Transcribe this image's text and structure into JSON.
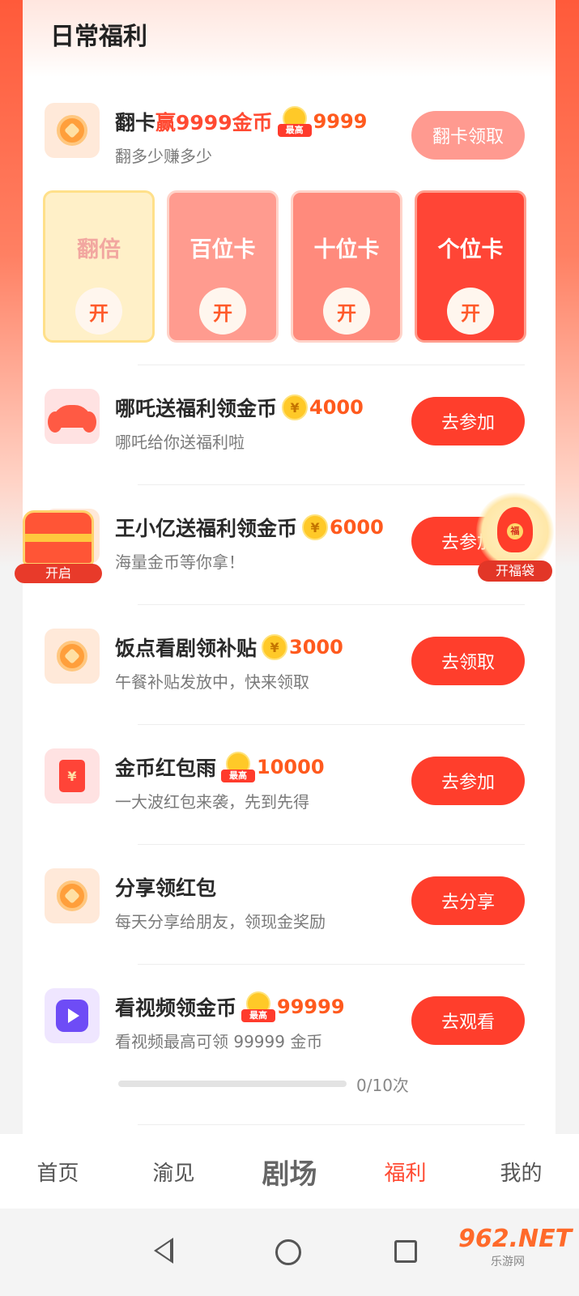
{
  "page": {
    "title": "日常福利"
  },
  "flip_task": {
    "title": "翻卡",
    "title_highlight": "赢9999金币",
    "max_tag": "最高",
    "reward": "9999",
    "subtitle": "翻多少赚多少",
    "button": "翻卡领取",
    "cards": [
      {
        "name": "翻倍",
        "open": "开"
      },
      {
        "name": "百位卡",
        "open": "开"
      },
      {
        "name": "十位卡",
        "open": "开"
      },
      {
        "name": "个位卡",
        "open": "开"
      }
    ]
  },
  "tasks": [
    {
      "title": "哪吒送福利领金币",
      "coin": "¥",
      "reward": "4000",
      "subtitle": "哪吒给你送福利啦",
      "button": "去参加",
      "icon": "hair-icon"
    },
    {
      "title": "王小亿送福利领金币",
      "coin": "¥",
      "reward": "6000",
      "subtitle": "海量金币等你拿！",
      "button": "去参加",
      "icon": "gift-icon"
    },
    {
      "title": "饭点看剧领补贴",
      "coin": "¥",
      "reward": "3000",
      "subtitle": "午餐补贴发放中，快来领取",
      "button": "去领取",
      "icon": "coin-icon"
    },
    {
      "title": "金币红包雨",
      "max_tag": "最高",
      "reward": "10000",
      "subtitle": "一大波红包来袭，先到先得",
      "button": "去参加",
      "icon": "red-envelope-icon",
      "icon_glyph": "¥"
    },
    {
      "title": "分享领红包",
      "subtitle": "每天分享给朋友，领现金奖励",
      "button": "去分享",
      "icon": "coin-icon"
    },
    {
      "title": "看视频领金币",
      "max_tag": "最高",
      "reward": "99999",
      "subtitle": "看视频最高可领 99999 金币",
      "button": "去观看",
      "icon": "play-icon"
    }
  ],
  "video_progress": {
    "current": 0,
    "total": 10,
    "text": "0/10次"
  },
  "floating": {
    "chest_label": "开启",
    "bag_label": "开福袋",
    "bag_glyph": "福"
  },
  "bottom_nav": [
    {
      "label": "首页"
    },
    {
      "label": "渝见"
    },
    {
      "label": "剧场"
    },
    {
      "label": "福利",
      "active": true
    },
    {
      "label": "我的"
    }
  ],
  "watermark": {
    "main": "962.NET",
    "sub": "乐游网"
  },
  "colors": {
    "accent": "#ff4a32",
    "button": "#ff3e2c",
    "button_light": "#ff9a90"
  }
}
